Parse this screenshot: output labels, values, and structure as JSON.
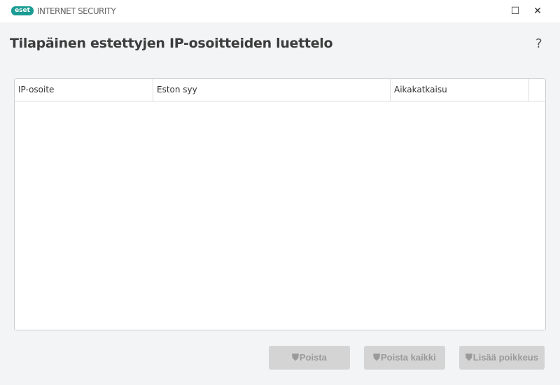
{
  "titlebar": {
    "logo": "eset",
    "product": "INTERNET SECURITY",
    "maximize": "☐",
    "close": "✕"
  },
  "header": {
    "title": "Tilapäinen estettyjen IP-osoitteiden luettelo",
    "help": "?"
  },
  "table": {
    "columns": [
      "IP-osoite",
      "Eston syy",
      "Aikakatkaisu"
    ],
    "rows": []
  },
  "buttons": {
    "remove": "Poista",
    "remove_all": "Poista kaikki",
    "add_exception": "Lisää poikkeus"
  },
  "icons": {
    "shield": "⛊"
  }
}
